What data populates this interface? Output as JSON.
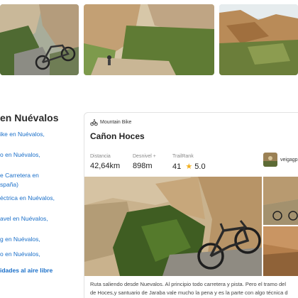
{
  "sidebar": {
    "title": "en Nuévalos",
    "links": [
      "ike en Nuévalos,",
      "o en Nuévalos,",
      "e Carretera en",
      "spaña)",
      "éctrica en Nuévalos,",
      "avel en Nuévalos,",
      "g en Nuévalos,",
      "o en Nuévalos,"
    ],
    "more": "idades al aire libre"
  },
  "card": {
    "activity": "Mountain Bike",
    "title": "Cañon Hoces",
    "stats": [
      {
        "label": "Distancia",
        "value": "42,64km"
      },
      {
        "label": "Desnivel +",
        "value": "898m"
      },
      {
        "label": "TrailRank",
        "value": "41",
        "rating": "5.0"
      }
    ],
    "author": "veigagp",
    "description_line1": "Ruta saliendo desde Nuevalos. Al principio todo carretera y pista. Pero el tramo del",
    "description_line2": "de Hoces,y santuario de Jaraba vale mucho la pena y es la parte con algo técnica d"
  },
  "icons": {
    "activity": "mountain-bike-icon",
    "rating": "star-icon"
  },
  "colors": {
    "link": "#1a6fc9",
    "star": "#f2b01e",
    "text": "#222222"
  }
}
